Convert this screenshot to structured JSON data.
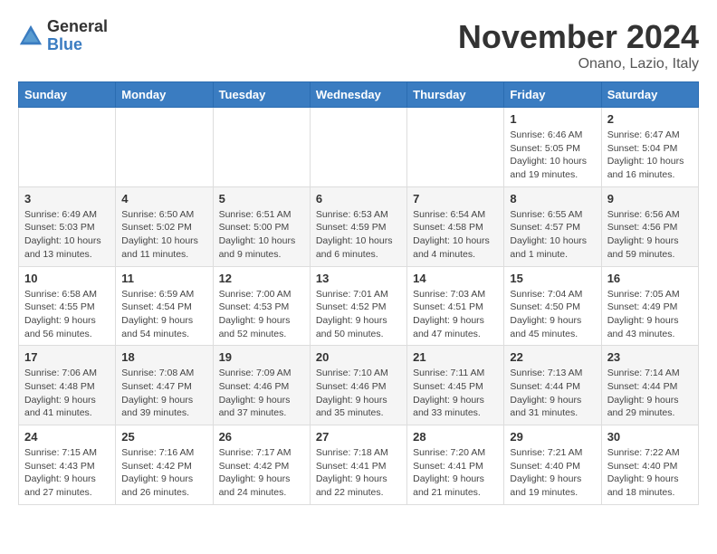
{
  "header": {
    "logo_general": "General",
    "logo_blue": "Blue",
    "month_title": "November 2024",
    "location": "Onano, Lazio, Italy"
  },
  "days_of_week": [
    "Sunday",
    "Monday",
    "Tuesday",
    "Wednesday",
    "Thursday",
    "Friday",
    "Saturday"
  ],
  "weeks": [
    [
      {
        "day": "",
        "info": ""
      },
      {
        "day": "",
        "info": ""
      },
      {
        "day": "",
        "info": ""
      },
      {
        "day": "",
        "info": ""
      },
      {
        "day": "",
        "info": ""
      },
      {
        "day": "1",
        "info": "Sunrise: 6:46 AM\nSunset: 5:05 PM\nDaylight: 10 hours and 19 minutes."
      },
      {
        "day": "2",
        "info": "Sunrise: 6:47 AM\nSunset: 5:04 PM\nDaylight: 10 hours and 16 minutes."
      }
    ],
    [
      {
        "day": "3",
        "info": "Sunrise: 6:49 AM\nSunset: 5:03 PM\nDaylight: 10 hours and 13 minutes."
      },
      {
        "day": "4",
        "info": "Sunrise: 6:50 AM\nSunset: 5:02 PM\nDaylight: 10 hours and 11 minutes."
      },
      {
        "day": "5",
        "info": "Sunrise: 6:51 AM\nSunset: 5:00 PM\nDaylight: 10 hours and 9 minutes."
      },
      {
        "day": "6",
        "info": "Sunrise: 6:53 AM\nSunset: 4:59 PM\nDaylight: 10 hours and 6 minutes."
      },
      {
        "day": "7",
        "info": "Sunrise: 6:54 AM\nSunset: 4:58 PM\nDaylight: 10 hours and 4 minutes."
      },
      {
        "day": "8",
        "info": "Sunrise: 6:55 AM\nSunset: 4:57 PM\nDaylight: 10 hours and 1 minute."
      },
      {
        "day": "9",
        "info": "Sunrise: 6:56 AM\nSunset: 4:56 PM\nDaylight: 9 hours and 59 minutes."
      }
    ],
    [
      {
        "day": "10",
        "info": "Sunrise: 6:58 AM\nSunset: 4:55 PM\nDaylight: 9 hours and 56 minutes."
      },
      {
        "day": "11",
        "info": "Sunrise: 6:59 AM\nSunset: 4:54 PM\nDaylight: 9 hours and 54 minutes."
      },
      {
        "day": "12",
        "info": "Sunrise: 7:00 AM\nSunset: 4:53 PM\nDaylight: 9 hours and 52 minutes."
      },
      {
        "day": "13",
        "info": "Sunrise: 7:01 AM\nSunset: 4:52 PM\nDaylight: 9 hours and 50 minutes."
      },
      {
        "day": "14",
        "info": "Sunrise: 7:03 AM\nSunset: 4:51 PM\nDaylight: 9 hours and 47 minutes."
      },
      {
        "day": "15",
        "info": "Sunrise: 7:04 AM\nSunset: 4:50 PM\nDaylight: 9 hours and 45 minutes."
      },
      {
        "day": "16",
        "info": "Sunrise: 7:05 AM\nSunset: 4:49 PM\nDaylight: 9 hours and 43 minutes."
      }
    ],
    [
      {
        "day": "17",
        "info": "Sunrise: 7:06 AM\nSunset: 4:48 PM\nDaylight: 9 hours and 41 minutes."
      },
      {
        "day": "18",
        "info": "Sunrise: 7:08 AM\nSunset: 4:47 PM\nDaylight: 9 hours and 39 minutes."
      },
      {
        "day": "19",
        "info": "Sunrise: 7:09 AM\nSunset: 4:46 PM\nDaylight: 9 hours and 37 minutes."
      },
      {
        "day": "20",
        "info": "Sunrise: 7:10 AM\nSunset: 4:46 PM\nDaylight: 9 hours and 35 minutes."
      },
      {
        "day": "21",
        "info": "Sunrise: 7:11 AM\nSunset: 4:45 PM\nDaylight: 9 hours and 33 minutes."
      },
      {
        "day": "22",
        "info": "Sunrise: 7:13 AM\nSunset: 4:44 PM\nDaylight: 9 hours and 31 minutes."
      },
      {
        "day": "23",
        "info": "Sunrise: 7:14 AM\nSunset: 4:44 PM\nDaylight: 9 hours and 29 minutes."
      }
    ],
    [
      {
        "day": "24",
        "info": "Sunrise: 7:15 AM\nSunset: 4:43 PM\nDaylight: 9 hours and 27 minutes."
      },
      {
        "day": "25",
        "info": "Sunrise: 7:16 AM\nSunset: 4:42 PM\nDaylight: 9 hours and 26 minutes."
      },
      {
        "day": "26",
        "info": "Sunrise: 7:17 AM\nSunset: 4:42 PM\nDaylight: 9 hours and 24 minutes."
      },
      {
        "day": "27",
        "info": "Sunrise: 7:18 AM\nSunset: 4:41 PM\nDaylight: 9 hours and 22 minutes."
      },
      {
        "day": "28",
        "info": "Sunrise: 7:20 AM\nSunset: 4:41 PM\nDaylight: 9 hours and 21 minutes."
      },
      {
        "day": "29",
        "info": "Sunrise: 7:21 AM\nSunset: 4:40 PM\nDaylight: 9 hours and 19 minutes."
      },
      {
        "day": "30",
        "info": "Sunrise: 7:22 AM\nSunset: 4:40 PM\nDaylight: 9 hours and 18 minutes."
      }
    ]
  ]
}
